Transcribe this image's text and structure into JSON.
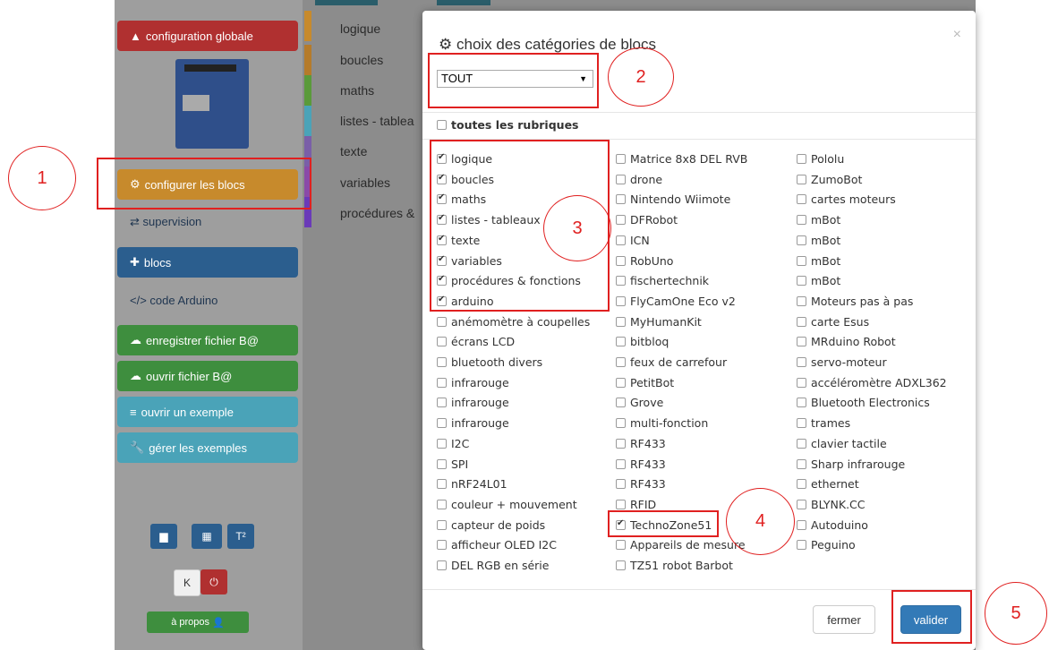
{
  "sidebar": {
    "config_global": "configuration globale",
    "configure_blocks": "configurer les blocs",
    "supervision": "supervision",
    "blocs": "blocs",
    "code_arduino": "code Arduino",
    "save_file": "enregistrer fichier B@",
    "open_file": "ouvrir fichier B@",
    "open_example": "ouvrir un exemple",
    "manage_examples": "gérer les exemples",
    "about": "à propos"
  },
  "categories": [
    "logique",
    "boucles",
    "maths",
    "listes - tablea",
    "texte",
    "variables",
    "procédures &"
  ],
  "modal": {
    "title": "choix des catégories de blocs",
    "select_value": "TOUT",
    "all_sections": "toutes les rubriques",
    "col1": [
      {
        "label": "logique",
        "checked": true
      },
      {
        "label": "boucles",
        "checked": true
      },
      {
        "label": "maths",
        "checked": true
      },
      {
        "label": "listes - tableaux",
        "checked": true
      },
      {
        "label": "texte",
        "checked": true
      },
      {
        "label": "variables",
        "checked": true
      },
      {
        "label": "procédures & fonctions",
        "checked": true
      },
      {
        "label": "arduino",
        "checked": true
      },
      {
        "label": "anémomètre à coupelles",
        "checked": false
      },
      {
        "label": "écrans LCD",
        "checked": false
      },
      {
        "label": "bluetooth divers",
        "checked": false
      },
      {
        "label": "infrarouge",
        "checked": false
      },
      {
        "label": "infrarouge",
        "checked": false
      },
      {
        "label": "infrarouge",
        "checked": false
      },
      {
        "label": "I2C",
        "checked": false
      },
      {
        "label": "SPI",
        "checked": false
      },
      {
        "label": "nRF24L01",
        "checked": false
      },
      {
        "label": "couleur + mouvement",
        "checked": false
      },
      {
        "label": "capteur de poids",
        "checked": false
      },
      {
        "label": "afficheur OLED I2C",
        "checked": false
      },
      {
        "label": "DEL RGB en série",
        "checked": false
      }
    ],
    "col2": [
      {
        "label": "Matrice 8x8 DEL RVB",
        "checked": false
      },
      {
        "label": "drone",
        "checked": false
      },
      {
        "label": "Nintendo Wiimote",
        "checked": false
      },
      {
        "label": "DFRobot",
        "checked": false
      },
      {
        "label": "ICN",
        "checked": false
      },
      {
        "label": "RobUno",
        "checked": false
      },
      {
        "label": "fischertechnik",
        "checked": false
      },
      {
        "label": "FlyCamOne Eco v2",
        "checked": false
      },
      {
        "label": "MyHumanKit",
        "checked": false
      },
      {
        "label": "bitbloq",
        "checked": false
      },
      {
        "label": "feux de carrefour",
        "checked": false
      },
      {
        "label": "PetitBot",
        "checked": false
      },
      {
        "label": "Grove",
        "checked": false
      },
      {
        "label": "multi-fonction",
        "checked": false
      },
      {
        "label": "RF433",
        "checked": false
      },
      {
        "label": "RF433",
        "checked": false
      },
      {
        "label": "RF433",
        "checked": false
      },
      {
        "label": "RFID",
        "checked": false
      },
      {
        "label": "TechnoZone51",
        "checked": true
      },
      {
        "label": "Appareils de mesure",
        "checked": false
      },
      {
        "label": "TZ51 robot Barbot",
        "checked": false
      }
    ],
    "col3": [
      {
        "label": "Pololu",
        "checked": false
      },
      {
        "label": "ZumoBot",
        "checked": false
      },
      {
        "label": "cartes moteurs",
        "checked": false
      },
      {
        "label": "mBot",
        "checked": false
      },
      {
        "label": "mBot",
        "checked": false
      },
      {
        "label": "mBot",
        "checked": false
      },
      {
        "label": "mBot",
        "checked": false
      },
      {
        "label": "Moteurs pas à pas",
        "checked": false
      },
      {
        "label": "carte Esus",
        "checked": false
      },
      {
        "label": "MRduino Robot",
        "checked": false
      },
      {
        "label": "servo-moteur",
        "checked": false
      },
      {
        "label": "accéléromètre ADXL362",
        "checked": false
      },
      {
        "label": "Bluetooth Electronics",
        "checked": false
      },
      {
        "label": "trames",
        "checked": false
      },
      {
        "label": "clavier tactile",
        "checked": false
      },
      {
        "label": "Sharp infrarouge",
        "checked": false
      },
      {
        "label": "ethernet",
        "checked": false
      },
      {
        "label": "BLYNK.CC",
        "checked": false
      },
      {
        "label": "Autoduino",
        "checked": false
      },
      {
        "label": "Peguino",
        "checked": false
      }
    ],
    "close_label": "fermer",
    "validate_label": "valider"
  },
  "annotations": [
    "1",
    "2",
    "3",
    "4",
    "5"
  ],
  "colors": {
    "danger": "#b03030",
    "warning": "#c78a2c",
    "primary": "#2b5e8e",
    "success": "#3e8e3e",
    "info": "#4aa3b8",
    "annotation": "#e02020"
  }
}
